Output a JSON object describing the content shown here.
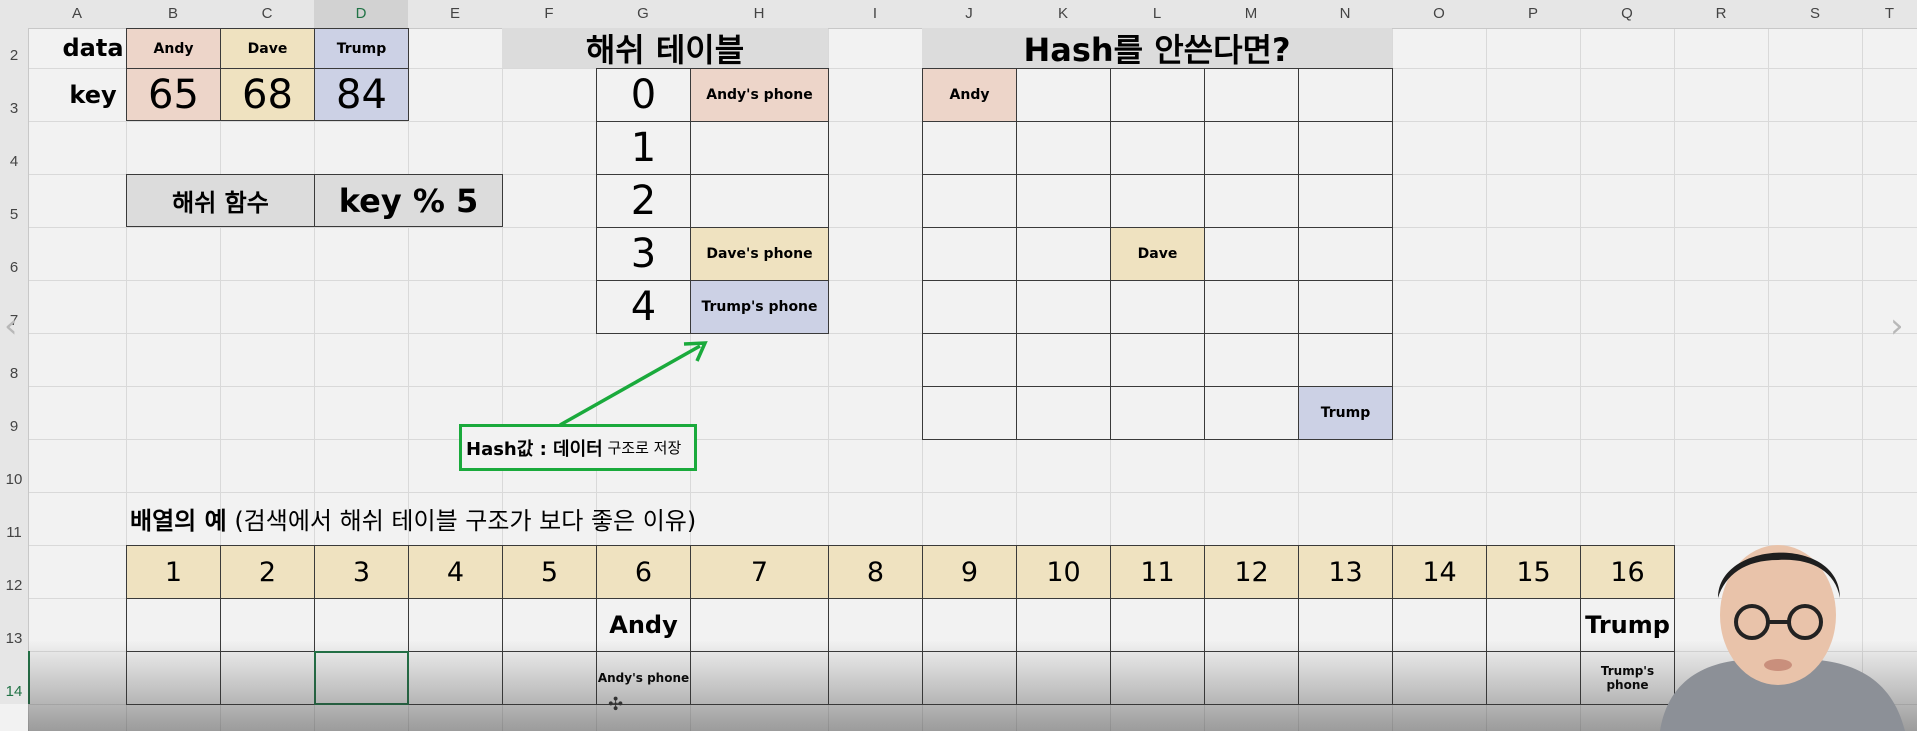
{
  "columns": [
    "A",
    "B",
    "C",
    "D",
    "E",
    "F",
    "G",
    "H",
    "I",
    "J",
    "K",
    "L",
    "M",
    "N",
    "O",
    "P",
    "Q",
    "R",
    "S",
    "T"
  ],
  "selected_column": "D",
  "rows": [
    "2",
    "3",
    "4",
    "5",
    "6",
    "7",
    "8",
    "9",
    "10",
    "11",
    "12",
    "13",
    "14"
  ],
  "selected_row": "14",
  "data_table": {
    "label_data": "data",
    "label_key": "key",
    "names": [
      "Andy",
      "Dave",
      "Trump"
    ],
    "keys": [
      "65",
      "68",
      "84"
    ]
  },
  "hash_function": {
    "label": "해쉬 함수",
    "formula": "key % 5"
  },
  "hash_table": {
    "title": "해쉬 테이블",
    "indices": [
      "0",
      "1",
      "2",
      "3",
      "4"
    ],
    "values": [
      "Andy's phone",
      "",
      "",
      "Dave's phone",
      "Trump's phone"
    ]
  },
  "no_hash": {
    "title": "Hash를 안쓴다면?",
    "andy": "Andy",
    "dave": "Dave",
    "trump": "Trump"
  },
  "annotation": {
    "bold": "Hash값 : 데이터",
    "rest": " 구조로 저장"
  },
  "array_example": {
    "title_bold": "배열의 예",
    "title_rest": " (검색에서 해쉬 테이블 구조가 보다 좋은 이유)",
    "numbers": [
      "1",
      "2",
      "3",
      "4",
      "5",
      "6",
      "7",
      "8",
      "9",
      "10",
      "11",
      "12",
      "13",
      "14",
      "15",
      "16"
    ],
    "row_names": {
      "6": "Andy",
      "16": "Trump"
    },
    "row_values": {
      "6": "Andy's phone",
      "16": "Trump's phone"
    }
  },
  "colors": {
    "pink": "#edd5c9",
    "tan": "#efe2c0",
    "blue": "#ccd1e5",
    "gray": "#dcdcdc",
    "green": "#1aaa3c",
    "excel_green": "#217346"
  },
  "icons": {
    "left_nav": "chevron-left-icon",
    "right_nav": "chevron-right-icon",
    "cursor": "crosshair-cursor-icon"
  }
}
